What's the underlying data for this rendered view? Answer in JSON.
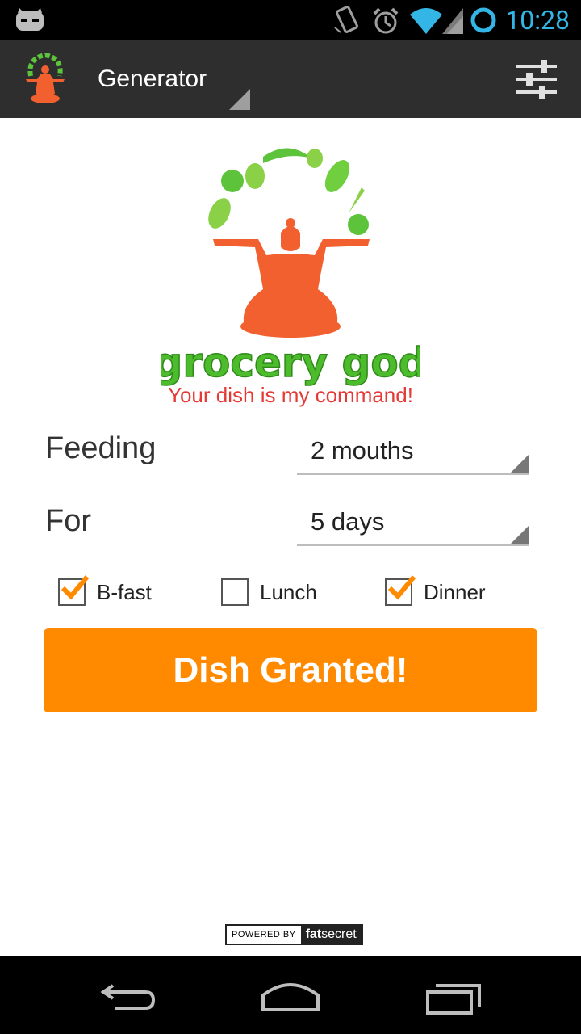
{
  "status": {
    "time": "10:28"
  },
  "actionbar": {
    "title": "Generator"
  },
  "logo": {
    "wordmark": "grocery god",
    "tagline": "Your dish is my command!"
  },
  "form": {
    "feeding": {
      "label": "Feeding",
      "value": "2 mouths"
    },
    "for": {
      "label": "For",
      "value": "5 days"
    },
    "meals": [
      {
        "label": "B-fast",
        "checked": true
      },
      {
        "label": "Lunch",
        "checked": false
      },
      {
        "label": "Dinner",
        "checked": true
      }
    ],
    "submit": "Dish Granted!"
  },
  "footer": {
    "powered_by": "POWERED BY",
    "brand_fat": "fat",
    "brand_secret": "secret"
  },
  "colors": {
    "accent": "#ff8a00",
    "statusBlue": "#33b5e5",
    "logoGreen": "#5cc33a",
    "logoOrange": "#f2602f"
  }
}
